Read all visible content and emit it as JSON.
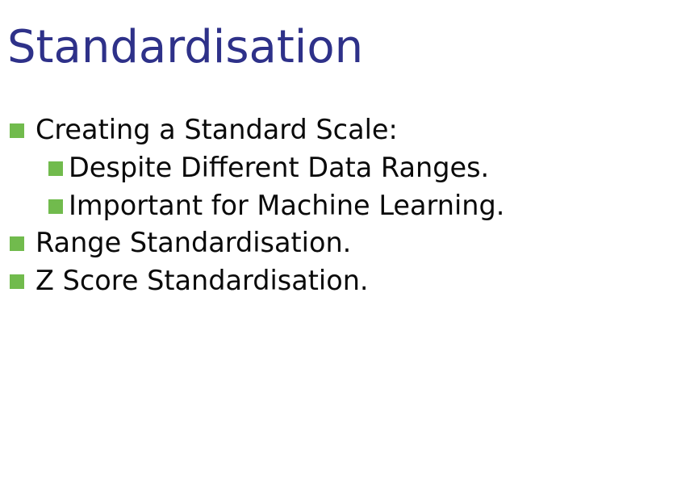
{
  "slide": {
    "title": "Standardisation",
    "bullets": [
      {
        "level": 1,
        "text": "Creating a Standard Scale:"
      },
      {
        "level": 2,
        "text": "Despite Different Data Ranges."
      },
      {
        "level": 2,
        "text": "Important for Machine Learning."
      },
      {
        "level": 1,
        "text": "Range Standardisation."
      },
      {
        "level": 1,
        "text": "Z Score Standardisation."
      }
    ]
  },
  "colors": {
    "title": "#2e3189",
    "bullet_marker": "#71bb4d",
    "text": "#0a0a0a",
    "background": "#ffffff"
  }
}
